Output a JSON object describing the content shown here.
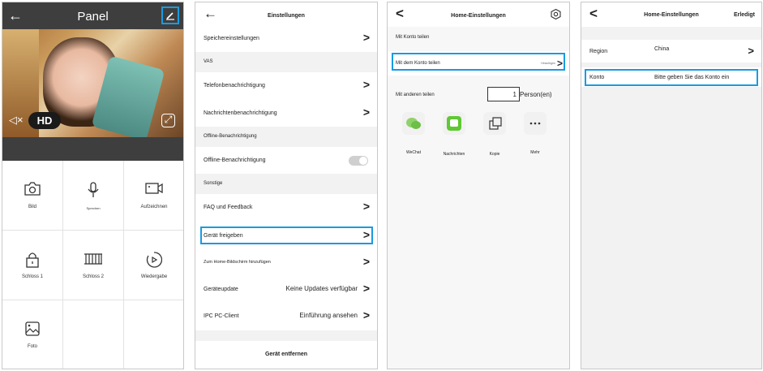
{
  "screen1": {
    "title": "Panel",
    "hd_label": "HD",
    "grid": [
      {
        "label": "Bild",
        "icon": "camera-icon"
      },
      {
        "label": "Sprechen",
        "icon": "microphone-icon"
      },
      {
        "label": "Aufzeichnen",
        "icon": "record-video-icon"
      },
      {
        "label": "Schloss 1",
        "icon": "lock-icon"
      },
      {
        "label": "Schloss 2",
        "icon": "gate-icon"
      },
      {
        "label": "Wiedergabe",
        "icon": "playback-icon"
      },
      {
        "label": "Foto",
        "icon": "photo-icon"
      }
    ]
  },
  "screen2": {
    "title": "Einstellungen",
    "rows": [
      {
        "label": "Speichereinstellungen"
      },
      {
        "label": "VAS"
      },
      {
        "label": "Telefonbenachrichtigung"
      },
      {
        "label": "Nachrichtenbenachrichtigung"
      },
      {
        "label": "Offline-Benachrichtigung"
      },
      {
        "label": "Offline-Benachrichtigung"
      },
      {
        "label": "Sonstige"
      },
      {
        "label": "FAQ und Feedback"
      },
      {
        "label": "Gerät freigeben"
      },
      {
        "label": "Zum Home-Bildschirm hinzufügen"
      },
      {
        "label": "Geräteupdate",
        "value": "Keine Updates verfügbar"
      },
      {
        "label": "IPC PC-Client",
        "value": "Einführung ansehen"
      }
    ],
    "remove_label": "Gerät entfernen"
  },
  "screen3": {
    "title": "Home-Einstellungen",
    "section_label": "Mit Konto teilen",
    "share_account_label": "Mit dem Konto teilen",
    "share_account_add": "Hinzufügen",
    "share_others_label": "Mit anderen teilen",
    "persons_count": "1",
    "persons_label": "Person(en)",
    "apps": [
      {
        "label": "WeChat",
        "icon": "wechat-icon",
        "color": "#8fd16a"
      },
      {
        "label": "Nachrichten",
        "icon": "messages-icon",
        "color": "#5fc832"
      },
      {
        "label": "Kopie",
        "icon": "copy-icon",
        "color": "#f1f1f1"
      },
      {
        "label": "Mehr",
        "icon": "more-icon",
        "color": "#f1f1f1"
      }
    ]
  },
  "screen4": {
    "title": "Home-Einstellungen",
    "done_label": "Erledigt",
    "region_label": "Region",
    "region_value": "China",
    "account_label": "Konto",
    "account_placeholder": "Bitte geben Sie das Konto ein"
  },
  "colors": {
    "highlight": "#1a9be0",
    "header_dark": "#3e3e3e",
    "section_bg": "#f2f2f2"
  }
}
